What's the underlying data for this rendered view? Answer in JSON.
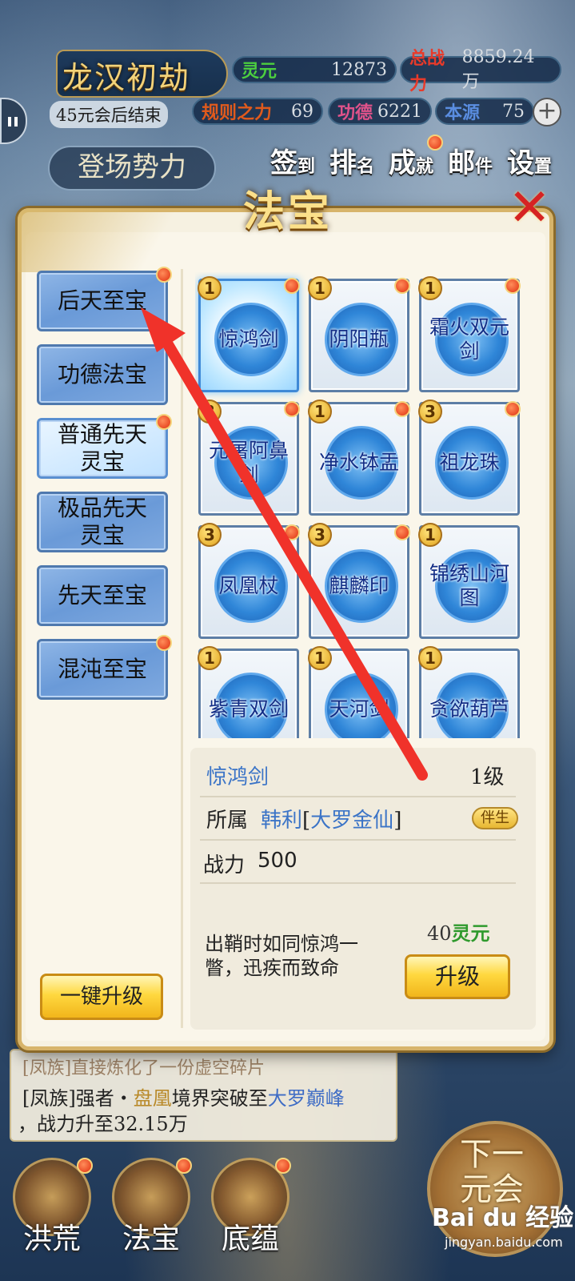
{
  "hud": {
    "title": "龙汉初劫",
    "countdown": "45元会后结束",
    "stats": [
      {
        "label": "灵元",
        "value": "12873",
        "color": "#4ccf3f"
      },
      {
        "label": "总战力",
        "value": "8859.24万",
        "color": "#e83a2a"
      },
      {
        "label": "规则之力",
        "value": "69",
        "color": "#e05a1c"
      },
      {
        "label": "功德",
        "value": "6221",
        "color": "#e0528a"
      },
      {
        "label": "本源",
        "value": "75",
        "color": "#5a8de0"
      }
    ],
    "plus": "+",
    "faction_button": "登场势力",
    "top_menu": [
      {
        "main": "签",
        "sub": "到"
      },
      {
        "main": "排",
        "sub": "名"
      },
      {
        "main": "成",
        "sub": "就"
      },
      {
        "main": "邮",
        "sub": "件"
      },
      {
        "main": "设",
        "sub": "置"
      }
    ]
  },
  "dialog": {
    "title": "法宝",
    "close": "✕",
    "categories": [
      {
        "label": "后天至宝",
        "badge": true,
        "selected": false
      },
      {
        "label": "功德法宝",
        "badge": false,
        "selected": false
      },
      {
        "label": "普通先天灵宝",
        "badge": true,
        "selected": true
      },
      {
        "label": "极品先天灵宝",
        "badge": false,
        "selected": false
      },
      {
        "label": "先天至宝",
        "badge": false,
        "selected": false
      },
      {
        "label": "混沌至宝",
        "badge": true,
        "selected": false
      }
    ],
    "treasures": [
      {
        "name": "惊鸿剑",
        "level": "1",
        "badge": true,
        "selected": true
      },
      {
        "name": "阴阳瓶",
        "level": "1",
        "badge": true,
        "selected": false
      },
      {
        "name": "霜火双元剑",
        "level": "1",
        "badge": true,
        "selected": false
      },
      {
        "name": "元屠阿鼻剑",
        "level": "3",
        "badge": true,
        "selected": false
      },
      {
        "name": "净水钵盂",
        "level": "1",
        "badge": true,
        "selected": false
      },
      {
        "name": "祖龙珠",
        "level": "3",
        "badge": true,
        "selected": false
      },
      {
        "name": "凤凰杖",
        "level": "3",
        "badge": true,
        "selected": false
      },
      {
        "name": "麒麟印",
        "level": "3",
        "badge": true,
        "selected": false
      },
      {
        "name": "锦绣山河图",
        "level": "1",
        "badge": false,
        "selected": false
      },
      {
        "name": "紫青双剑",
        "level": "1",
        "badge": false,
        "selected": false
      },
      {
        "name": "天河剑",
        "level": "1",
        "badge": false,
        "selected": false
      },
      {
        "name": "贪欲葫芦",
        "level": "1",
        "badge": false,
        "selected": false
      }
    ],
    "detail": {
      "name": "惊鸿剑",
      "level": "1级",
      "owner_label": "所属",
      "owner": "韩利",
      "owner_rank": "大罗金仙",
      "companion": "伴生",
      "power_label": "战力",
      "power": "500",
      "description": "出鞘时如同惊鸿一瞥，迅疾而致命",
      "cost_value": "40",
      "cost_currency": "灵元",
      "upgrade": "升级"
    },
    "one_click": "一键升级"
  },
  "log": {
    "faded": "[凤族]直接炼化了一份虚空碎片",
    "line1_tag": "[凤族]强者・",
    "line1_name": "盘凰",
    "line1_mid": "境界突破至",
    "line1_rank": "大罗巅峰",
    "line2": "，战力升至32.15万"
  },
  "bottom_nav": [
    {
      "label": "洪荒",
      "badge": true
    },
    {
      "label": "法宝",
      "badge": true
    },
    {
      "label": "底蕴",
      "badge": true
    }
  ],
  "next": "下一元会",
  "watermark": "Bai du 经验",
  "watermark_sub": "jingyan.baidu.com"
}
